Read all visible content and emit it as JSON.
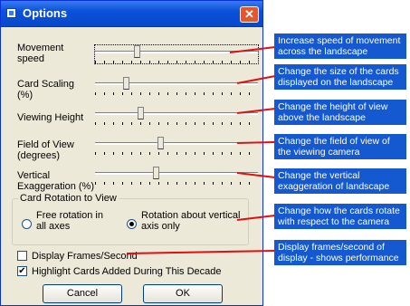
{
  "window": {
    "title": "Options",
    "close_label": "✕"
  },
  "sliders": [
    {
      "label": "Movement speed",
      "value_pct": 0.25
    },
    {
      "label": "Card Scaling (%)",
      "value_pct": 0.18
    },
    {
      "label": "Viewing Height",
      "value_pct": 0.27
    },
    {
      "label": "Field of View (degrees)",
      "value_pct": 0.4
    },
    {
      "label": "Vertical Exaggeration (%)",
      "value_pct": 0.37
    }
  ],
  "rotation_group": {
    "title": "Card Rotation to View",
    "option_free": "Free rotation in all axes",
    "option_vertical": "Rotation about vertical axis only",
    "selected": "vertical"
  },
  "checkboxes": {
    "display_frames": {
      "label": "Display Frames/Second",
      "checked": false
    },
    "highlight_cards": {
      "label": "Highlight Cards Added During This Decade",
      "checked": true
    }
  },
  "buttons": {
    "cancel": "Cancel",
    "ok": "OK"
  },
  "callouts": [
    "Increase speed of movement across the landscape",
    "Change the size of the cards displayed on the landscape",
    "Change the height of view above the landscape",
    "Change the field of view of the viewing camera",
    "Change the vertical exaggeration of landscape",
    "Change how the cards rotate with respect to the camera",
    "Display frames/second of display - shows performance"
  ],
  "colors": {
    "callout_bg": "#1459cf",
    "pointer_line": "#e01010",
    "titlebar": "#0a52d8"
  }
}
